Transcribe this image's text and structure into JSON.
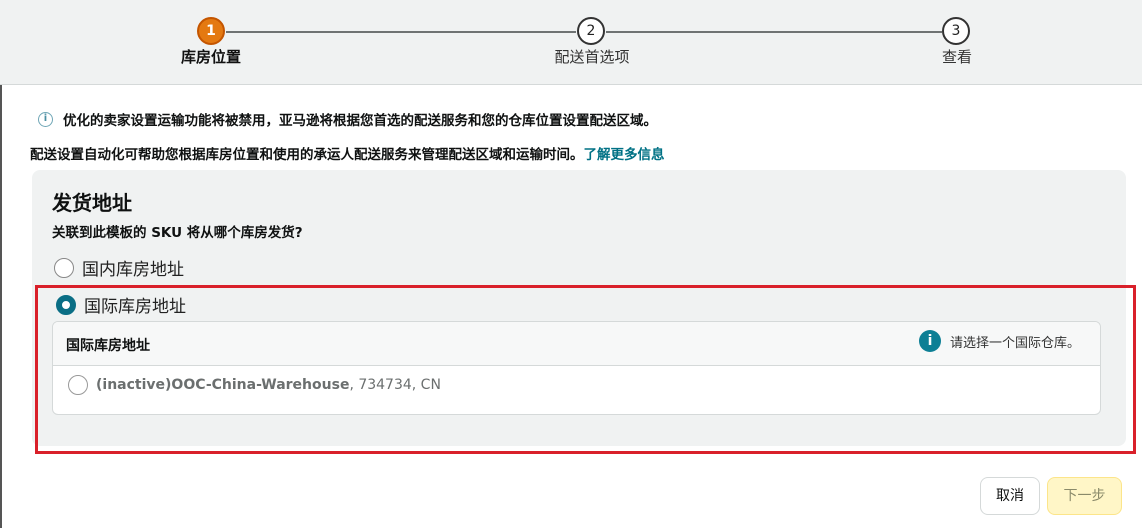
{
  "stepper": {
    "steps": [
      {
        "number": "1",
        "label": "库房位置",
        "active": true
      },
      {
        "number": "2",
        "label": "配送首选项",
        "active": false
      },
      {
        "number": "3",
        "label": "查看",
        "active": false
      }
    ]
  },
  "notice": {
    "icon": "info-icon",
    "text": "优化的卖家设置运输功能将被禁用，亚马逊将根据您首选的配送服务和您的仓库位置设置配送区域。"
  },
  "description": {
    "text": "配送设置自动化可帮助您根据库房位置和使用的承运人配送服务来管理配送区域和运输时间。",
    "link_text": "了解更多信息"
  },
  "ship_from": {
    "title": "发货地址",
    "question": "关联到此模板的 SKU 将从哪个库房发货?",
    "options": [
      {
        "label": "国内库房地址",
        "selected": false
      },
      {
        "label": "国际库房地址",
        "selected": true
      }
    ],
    "international": {
      "header": "国际库房地址",
      "hint": "请选择一个国际仓库。",
      "warehouse_name": "(inactive)OOC-China-Warehouse",
      "warehouse_detail": ", 734734, CN",
      "warehouse_selected": false
    }
  },
  "actions": {
    "cancel_label": "取消",
    "next_label": "下一步"
  },
  "colors": {
    "accent_teal": "#007185",
    "step_active": "#e47911",
    "highlight_red": "#d9202a",
    "next_button": "#fff6c7"
  }
}
